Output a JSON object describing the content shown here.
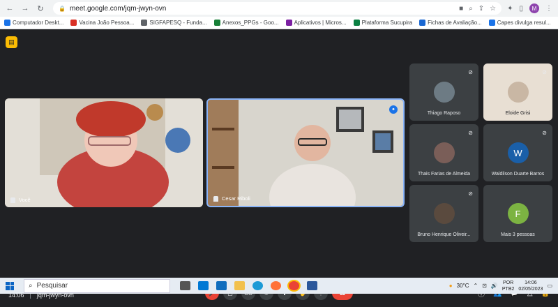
{
  "browser": {
    "url": "meet.google.com/jqm-jwyn-ovn",
    "profile_initial": "M",
    "bookmarks": [
      {
        "label": "Computador Deskt...",
        "color": "#1a73e8"
      },
      {
        "label": "Vacina João Pessoa...",
        "color": "#d93025"
      },
      {
        "label": "SIGFAPESQ - Funda...",
        "color": "#5f6368"
      },
      {
        "label": "Anexos_PPGs - Goo...",
        "color": "#188038"
      },
      {
        "label": "Aplicativos | Micros...",
        "color": "#7b1fa2"
      },
      {
        "label": "Plataforma Sucupira",
        "color": "#0b8043"
      },
      {
        "label": "Fichas de Avaliação...",
        "color": "#1967d2"
      },
      {
        "label": "Capes divulga resul...",
        "color": "#1a73e8"
      }
    ]
  },
  "tiles": {
    "you": {
      "name": "Você"
    },
    "main": {
      "name": "Cesar Riboli"
    },
    "small": [
      {
        "name": "Thiago Raposo",
        "color": "#6d7b84"
      },
      {
        "name": "Eloide Grisi",
        "color": "#c9b7a4"
      },
      {
        "name": "Thais Farias de Almeida",
        "color": "#7a5e58"
      },
      {
        "name": "Waldilson Duarte Barros",
        "initial": "W",
        "color": "#1a5fa8"
      },
      {
        "name": "Bruno Henrique Oliveir...",
        "color": "#5a4a3e"
      },
      {
        "name": "Mais 3 pessoas",
        "initial": "F",
        "color": "#7cb342"
      }
    ]
  },
  "meeting": {
    "time": "14:06",
    "code": "jqm-jwyn-ovn",
    "participant_count": "10"
  },
  "taskbar": {
    "search_placeholder": "Pesquisar",
    "temperature": "30°C",
    "lang_top": "POR",
    "lang_bottom": "PTB2",
    "clock_time": "14:06",
    "clock_date": "02/05/2023"
  }
}
